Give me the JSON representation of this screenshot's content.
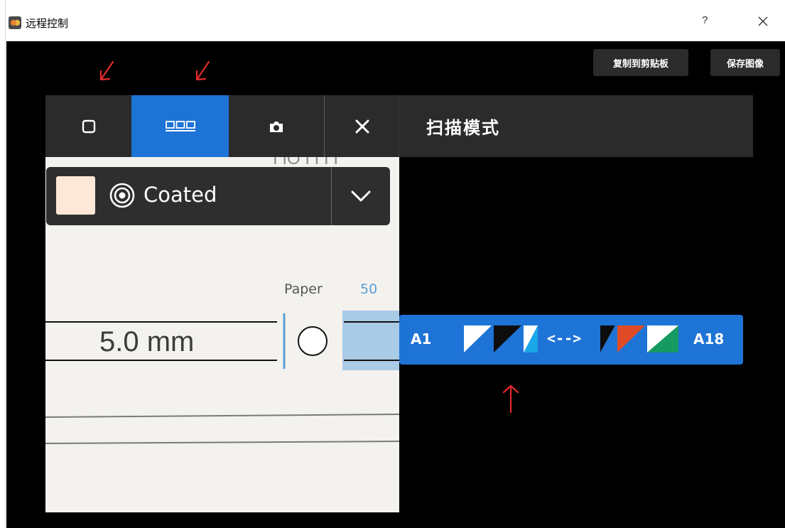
{
  "window": {
    "title": "远程控制",
    "help_label": "?",
    "app_icon": "app-logo-icon",
    "close_icon": "close-icon"
  },
  "toolbar_top": {
    "copy_label": "复制到剪贴板",
    "save_label": "保存图像"
  },
  "device": {
    "tools": [
      {
        "name": "single-mode",
        "icon": "square-icon"
      },
      {
        "name": "multi-mode",
        "icon": "strip-icon",
        "active": true
      },
      {
        "name": "camera",
        "icon": "camera-icon"
      },
      {
        "name": "close",
        "icon": "x-icon"
      }
    ],
    "mode_title": "扫描模式",
    "material": {
      "swatch_color": "#fde7d6",
      "icon": "target-icon",
      "label": "Coated",
      "dropdown_icon": "chevron-down-icon"
    },
    "paper": {
      "label": "Paper",
      "value": "50",
      "measurement": "5.0 mm"
    },
    "reading": {
      "start": "A1",
      "separator": "<-->",
      "end": "A18"
    }
  },
  "colors": {
    "accent": "#1e73d6",
    "panel": "#2b2b2b",
    "annotation": "#e52a2a"
  }
}
